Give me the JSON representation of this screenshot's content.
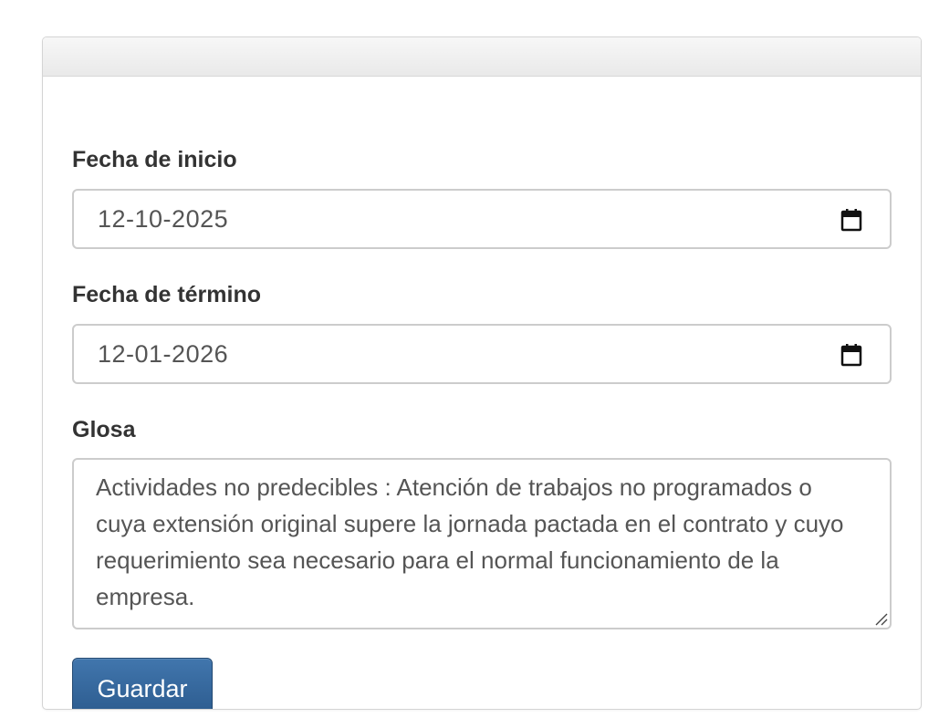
{
  "form": {
    "start_date": {
      "label": "Fecha de inicio",
      "value": "12-10-2025",
      "icon": "calendar-icon"
    },
    "end_date": {
      "label": "Fecha de término",
      "value": "12-01-2026",
      "icon": "calendar-icon"
    },
    "glosa": {
      "label": "Glosa",
      "value": "Actividades no predecibles : Atención de trabajos no programados o cuya extensión original supere la jornada pactada en el contrato y cuyo requerimiento sea necesario para el normal funcionamiento de la empresa."
    },
    "save_label": "Guardar"
  },
  "colors": {
    "button": "#336699",
    "border": "#cccccc",
    "text": "#333333"
  }
}
